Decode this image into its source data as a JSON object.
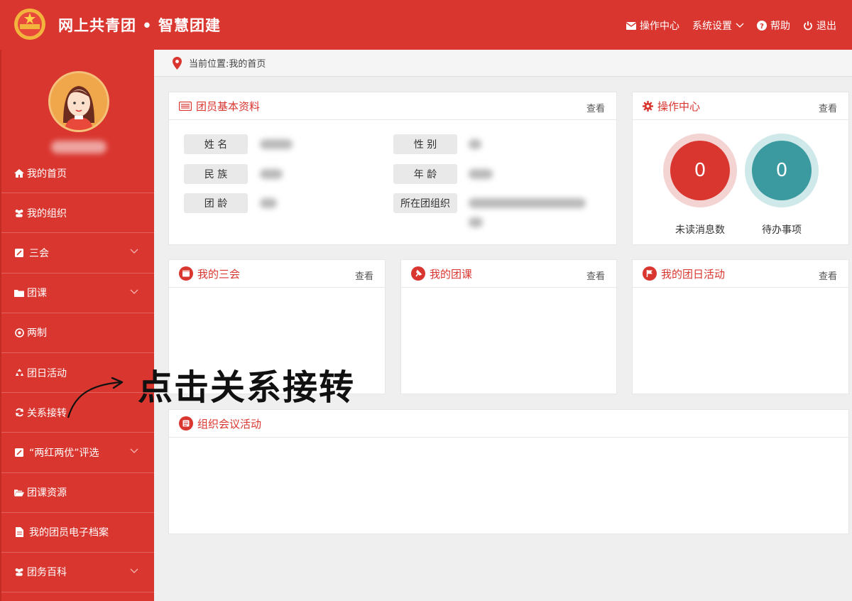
{
  "header": {
    "title": "网上共青团 • 智慧团建",
    "nav": [
      {
        "label": "操作中心",
        "icon": "envelope-icon"
      },
      {
        "label": "系统设置",
        "icon": "chevron-down-icon"
      },
      {
        "label": "帮助",
        "icon": "help-icon"
      },
      {
        "label": "退出",
        "icon": "power-icon"
      }
    ]
  },
  "sidebar": {
    "items": [
      {
        "label": "我的首页",
        "icon": "home-icon"
      },
      {
        "label": "我的组织",
        "icon": "users-icon"
      },
      {
        "label": "三会",
        "icon": "edit-icon",
        "expandable": true
      },
      {
        "label": "团课",
        "icon": "folder-icon",
        "expandable": true
      },
      {
        "label": "两制",
        "icon": "target-icon"
      },
      {
        "label": "团日活动",
        "icon": "recycle-icon"
      },
      {
        "label": "关系接转",
        "icon": "refresh-icon"
      },
      {
        "label": "“两红两优”评选",
        "icon": "edit-icon",
        "expandable": true
      },
      {
        "label": "团课资源",
        "icon": "folder-open-icon"
      },
      {
        "label": "我的团员电子档案",
        "icon": "document-icon"
      },
      {
        "label": "团务百科",
        "icon": "users-icon",
        "expandable": true
      }
    ]
  },
  "breadcrumb": {
    "text": "当前位置:我的首页"
  },
  "member_info": {
    "title": "团员基本资料",
    "more": "查看",
    "labels": {
      "name": "姓 名",
      "gender": "性 别",
      "ethnicity": "民 族",
      "age": "年 龄",
      "league_age": "团 龄",
      "org": "所在团组织"
    }
  },
  "operation_center": {
    "title": "操作中心",
    "more": "查看",
    "unread": {
      "value": "0",
      "label": "未读消息数"
    },
    "todo": {
      "value": "0",
      "label": "待办事项"
    }
  },
  "panels": {
    "three_meetings": {
      "title": "我的三会",
      "more": "查看"
    },
    "league_class": {
      "title": "我的团课",
      "more": "查看"
    },
    "league_day": {
      "title": "我的团日活动",
      "more": "查看"
    },
    "org_meetings": {
      "title": "组织会议活动"
    }
  },
  "annotation": {
    "text": "点击关系接转"
  },
  "colors": {
    "brand_red": "#d9362f",
    "teal": "#3a9aa0"
  }
}
